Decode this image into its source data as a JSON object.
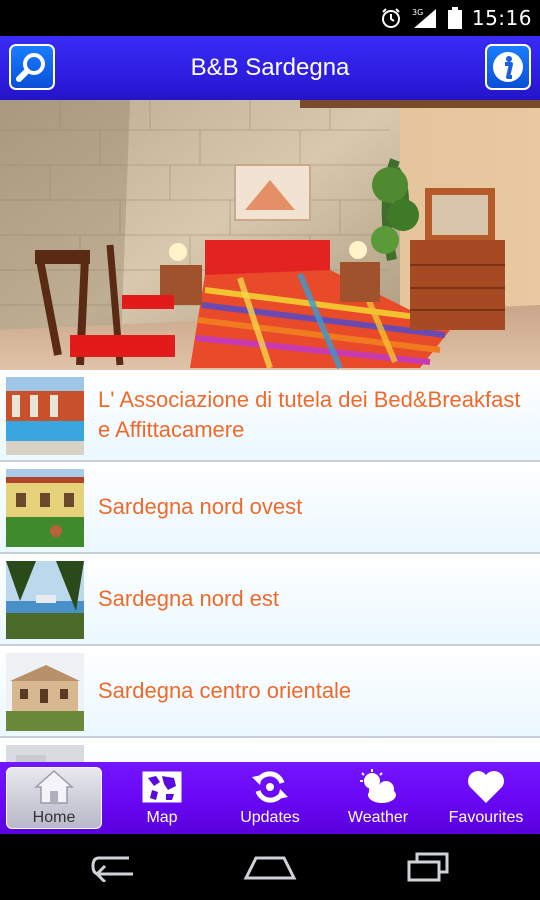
{
  "status_bar": {
    "time": "15:16",
    "network": "3G"
  },
  "header": {
    "title": "B&B Sardegna",
    "search_icon": "search-icon",
    "info_icon": "info-icon"
  },
  "hero": {
    "alt": "bedroom-photo"
  },
  "list": {
    "items": [
      {
        "label": "L' Associazione di tutela dei Bed&Breakfast e Affittacamere"
      },
      {
        "label": "Sardegna nord ovest"
      },
      {
        "label": "Sardegna nord est"
      },
      {
        "label": "Sardegna centro orientale"
      },
      {
        "label": ""
      }
    ]
  },
  "tabs": [
    {
      "label": "Home",
      "icon": "home-icon",
      "active": true
    },
    {
      "label": "Map",
      "icon": "map-icon",
      "active": false
    },
    {
      "label": "Updates",
      "icon": "updates-icon",
      "active": false
    },
    {
      "label": "Weather",
      "icon": "weather-icon",
      "active": false
    },
    {
      "label": "Favourites",
      "icon": "heart-icon",
      "active": false
    }
  ],
  "colors": {
    "title_bar": "#2f1fe3",
    "tab_bar": "#6a08f5",
    "item_text": "#ef6a2a"
  }
}
